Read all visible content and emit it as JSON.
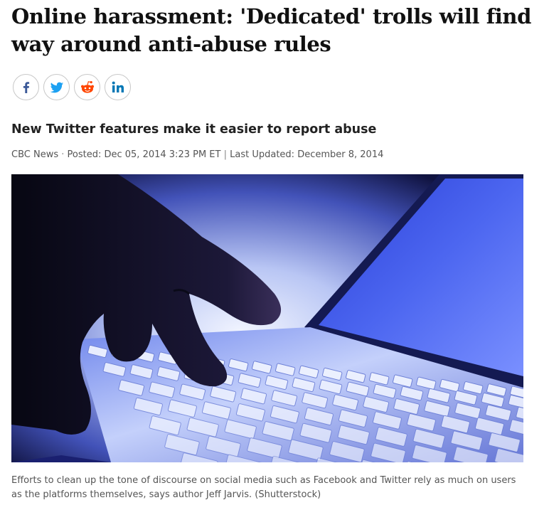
{
  "article": {
    "headline": "Online harassment: 'Dedicated' trolls will find way around anti-abuse rules",
    "deck": "New Twitter features make it easier to report abuse",
    "byline": {
      "source": "CBC News",
      "posted": "Posted: Dec 05, 2014 3:23 PM ET",
      "separator": "|",
      "updated": "Last Updated: December 8, 2014"
    },
    "image": {
      "caption": "Efforts to clean up the tone of discourse on social media such as Facebook and Twitter rely as much on users as the platforms themselves, says author Jeff Jarvis. (Shutterstock)"
    }
  },
  "share": {
    "buttons": [
      {
        "network": "facebook",
        "icon": "facebook-icon",
        "color": "#3b5998"
      },
      {
        "network": "twitter",
        "icon": "twitter-icon",
        "color": "#1da1f2"
      },
      {
        "network": "reddit",
        "icon": "reddit-icon",
        "color": "#ff4500"
      },
      {
        "network": "linkedin",
        "icon": "linkedin-icon",
        "color": "#0077b5"
      }
    ]
  },
  "colors": {
    "headline": "#111111",
    "meta_text": "#555555",
    "screen_blue": "#3a55e0"
  }
}
